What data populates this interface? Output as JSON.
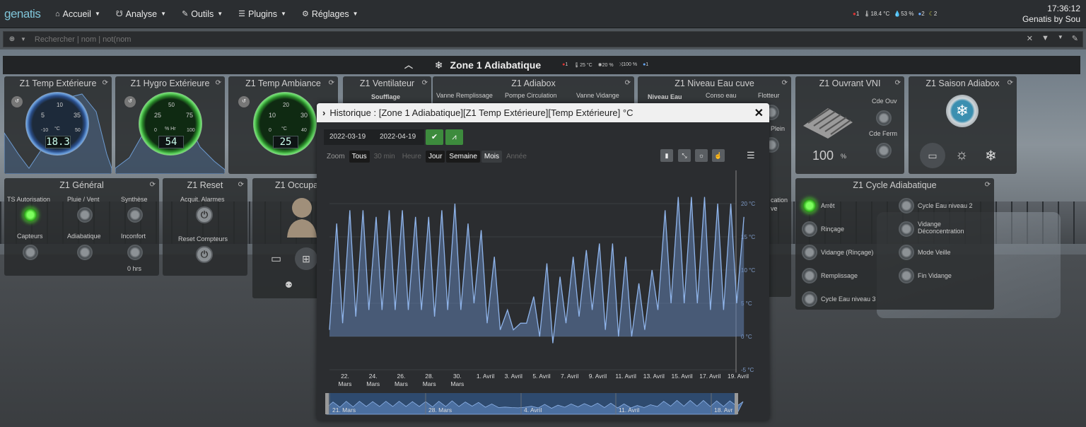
{
  "app": {
    "logo": "genatis"
  },
  "menu": [
    {
      "icon": "home-icon",
      "glyph": "⌂",
      "label": "Accueil"
    },
    {
      "icon": "stethoscope-icon",
      "glyph": "☋",
      "label": "Analyse"
    },
    {
      "icon": "wrench-icon",
      "glyph": "✎",
      "label": "Outils"
    },
    {
      "icon": "list-icon",
      "glyph": "☰",
      "label": "Plugins"
    },
    {
      "icon": "gear-icon",
      "glyph": "⚙",
      "label": "Réglages"
    }
  ],
  "status": {
    "alarm": "1",
    "temp": "18.4 °C",
    "humidity": "53 %",
    "users": "2",
    "moon": "2"
  },
  "clock": {
    "time": "17:36:12",
    "user": "Genatis by Sou"
  },
  "search": {
    "placeholder": "Rechercher | nom | not(nom"
  },
  "zone": {
    "title": "Zone 1 Adiabatique",
    "alarm": "1",
    "temp": "25 °C",
    "fan": "20 %",
    "vent": "100 %",
    "users": "1"
  },
  "tiles": {
    "temp_ext": {
      "title": "Z1 Temp Extérieure",
      "value": "18.3",
      "unit": "°C",
      "ticks": [
        "5",
        "10",
        "35",
        "-10",
        "50"
      ]
    },
    "hygro_ext": {
      "title": "Z1 Hygro Extérieure",
      "value": "54",
      "unit": "% Hr",
      "ticks": [
        "50",
        "25",
        "75",
        "0",
        "100"
      ]
    },
    "temp_amb": {
      "title": "Z1 Temp Ambiance",
      "value": "25",
      "unit": "°C",
      "ticks": [
        "20",
        "10",
        "30",
        "0",
        "40"
      ]
    },
    "ventilateur": {
      "title": "Z1 Ventilateur",
      "soufflage": "Soufflage"
    },
    "adiabox": {
      "title": "Z1 Adiabox",
      "labels": [
        "Vanne Remplissage",
        "Pompe Circulation",
        "Vanne Vidange"
      ]
    },
    "niveau": {
      "title": "Z1 Niveau Eau cuve",
      "labels": [
        "Niveau Eau",
        "Conso eau",
        "Flotteur",
        "Plein"
      ]
    },
    "vni": {
      "title": "Z1 Ouvrant VNI",
      "cde_ouv": "Cde Ouv",
      "cde_ferm": "Cde Ferm",
      "value": "100",
      "unit": "%"
    },
    "saison": {
      "title": "Z1 Saison Adiabox"
    },
    "general": {
      "title": "Z1 Général",
      "labels": [
        "TS Autorisation",
        "Pluie / Vent",
        "Synthèse",
        "Capteurs",
        "Adiabatique",
        "Inconfort"
      ],
      "inconfort_value": "0 hrs"
    },
    "reset": {
      "title": "Z1 Reset",
      "labels": [
        "Acquit. Alarmes",
        "Reset Compteurs"
      ]
    },
    "occupa": {
      "title": "Z1 Occupa"
    },
    "cycle": {
      "title": "Z1 Cycle Adiabatique",
      "left": [
        "Arrêt",
        "Rinçage",
        "Vidange (Rinçage)",
        "Remplissage",
        "Cycle Eau niveau 3"
      ],
      "right": [
        "Cycle Eau niveau 2",
        "Vidange Déconcentration",
        "Mode Veille",
        "Fin Vidange"
      ]
    },
    "partial": {
      "line1": "cation",
      "line2": "ve"
    }
  },
  "modal": {
    "title": "Historique : [Zone 1 Adiabatique][Z1 Temp Extérieure][Temp Extérieure] °C",
    "date_from": "2022-03-19",
    "date_to": "2022-04-19",
    "zoom_label": "Zoom",
    "zoom": [
      "Tous",
      "30 min",
      "Heure",
      "Jour",
      "Semaine",
      "Mois",
      "Année"
    ]
  },
  "chart_data": {
    "type": "area",
    "ylim": [
      -5,
      25
    ],
    "y_ticks": [
      "20 °C",
      "15 °C",
      "10 °C",
      "5 °C",
      "0 °C",
      "-5 °C"
    ],
    "x_ticks": [
      "22. Mars",
      "24. Mars",
      "26. Mars",
      "28. Mars",
      "30. Mars",
      "1. Avril",
      "3. Avril",
      "5. Avril",
      "7. Avril",
      "9. Avril",
      "11. Avril",
      "13. Avril",
      "15. Avril",
      "17. Avril",
      "19. Avril"
    ],
    "navigator_labels": [
      "21. Mars",
      "28. Mars",
      "4. Avril",
      "11. Avril",
      "18. Avr"
    ],
    "x": [
      "2022-03-19",
      "2022-03-20",
      "2022-03-21",
      "2022-03-22",
      "2022-03-23",
      "2022-03-24",
      "2022-03-25",
      "2022-03-26",
      "2022-03-27",
      "2022-03-28",
      "2022-03-29",
      "2022-03-30",
      "2022-03-31",
      "2022-04-01",
      "2022-04-02",
      "2022-04-03",
      "2022-04-04",
      "2022-04-05",
      "2022-04-06",
      "2022-04-07",
      "2022-04-08",
      "2022-04-09",
      "2022-04-10",
      "2022-04-11",
      "2022-04-12",
      "2022-04-13",
      "2022-04-14",
      "2022-04-15",
      "2022-04-16",
      "2022-04-17",
      "2022-04-18",
      "2022-04-19"
    ],
    "series": [
      {
        "min": [
          1,
          2,
          3,
          4,
          4,
          4,
          4,
          4,
          3,
          4,
          4,
          5,
          2,
          1,
          1,
          2,
          0,
          -1,
          2,
          3,
          4,
          1,
          0,
          0,
          1,
          4,
          5,
          5,
          5,
          4,
          4,
          5
        ],
        "max": [
          17,
          19,
          19,
          18,
          19,
          19,
          18,
          18,
          19,
          20,
          17,
          16,
          12,
          4,
          2,
          6,
          11,
          9,
          12,
          13,
          14,
          14,
          12,
          8,
          10,
          19,
          21,
          21,
          21,
          20,
          20,
          18
        ]
      }
    ]
  }
}
